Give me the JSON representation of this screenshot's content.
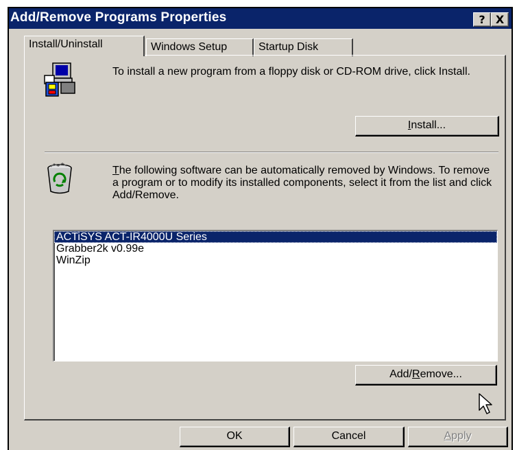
{
  "window": {
    "title": "Add/Remove Programs Properties",
    "help_button": "?",
    "close_button": "X"
  },
  "tabs": [
    {
      "label": "Install/Uninstall",
      "active": true
    },
    {
      "label": "Windows Setup",
      "active": false
    },
    {
      "label": "Startup Disk",
      "active": false
    }
  ],
  "install_section": {
    "icon": "computer-install-icon",
    "description": "To install a new program from a floppy disk or CD-ROM drive, click Install.",
    "button_pre": "",
    "button_accel": "I",
    "button_post": "nstall..."
  },
  "remove_section": {
    "icon": "recycle-bin-icon",
    "description_accel": "T",
    "description_rest": "he following software can be automatically removed by Windows. To remove a program or to modify its installed components, select it from the list and click Add/Remove.",
    "programs": [
      {
        "name": "ACTiSYS ACT-IR4000U Series",
        "selected": true
      },
      {
        "name": "Grabber2k v0.99e",
        "selected": false
      },
      {
        "name": "WinZip",
        "selected": false
      }
    ],
    "button_pre": "Add/",
    "button_accel": "R",
    "button_post": "emove..."
  },
  "footer": {
    "ok_label": "OK",
    "cancel_label": "Cancel",
    "apply_accel": "A",
    "apply_rest": "pply",
    "apply_enabled": false
  },
  "colors": {
    "titlebar": "#0a246a",
    "face": "#d4d0c8",
    "selection": "#0a246a"
  }
}
